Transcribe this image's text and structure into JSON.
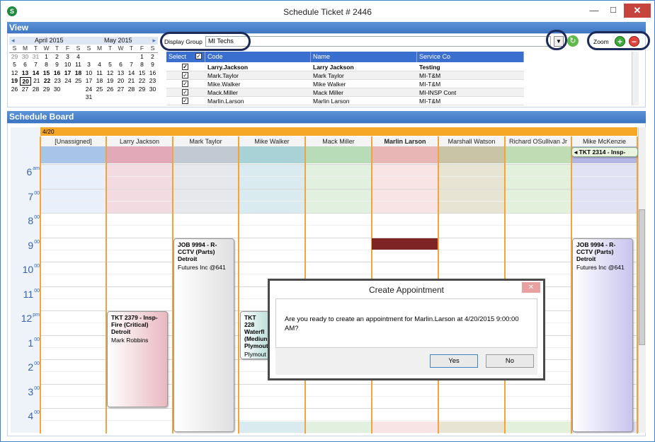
{
  "window": {
    "title": "Schedule Ticket # 2446",
    "app_icon": "S",
    "min": "—",
    "max": "☐",
    "close": "✕"
  },
  "view": {
    "header": "View",
    "calendars": [
      {
        "month": "April 2015",
        "dow": [
          "S",
          "M",
          "T",
          "W",
          "T",
          "F",
          "S"
        ],
        "weeks": [
          [
            "29",
            "30",
            "31",
            "1",
            "2",
            "3",
            "4"
          ],
          [
            "5",
            "6",
            "7",
            "8",
            "9",
            "10",
            "11"
          ],
          [
            "12",
            "13",
            "14",
            "15",
            "16",
            "17",
            "18"
          ],
          [
            "19",
            "20",
            "21",
            "22",
            "23",
            "24",
            "25"
          ],
          [
            "26",
            "27",
            "28",
            "29",
            "30",
            "",
            ""
          ]
        ]
      },
      {
        "month": "May 2015",
        "dow": [
          "S",
          "M",
          "T",
          "W",
          "T",
          "F",
          "S"
        ],
        "weeks": [
          [
            "",
            "",
            "",
            "",
            "",
            "1",
            "2"
          ],
          [
            "3",
            "4",
            "5",
            "6",
            "7",
            "8",
            "9"
          ],
          [
            "10",
            "11",
            "12",
            "13",
            "14",
            "15",
            "16"
          ],
          [
            "17",
            "18",
            "19",
            "20",
            "21",
            "22",
            "23"
          ],
          [
            "24",
            "25",
            "26",
            "27",
            "28",
            "29",
            "30"
          ],
          [
            "31",
            "",
            "",
            "",
            "",
            "",
            ""
          ]
        ]
      }
    ],
    "display_group_label": "Display Group",
    "display_group_value": "MI Techs",
    "zoom_label": "Zoom",
    "grid": {
      "headers": [
        "Select",
        "Code",
        "Name",
        "Service Co"
      ],
      "rows": [
        {
          "code": "Larry.Jackson",
          "name": "Larry Jackson",
          "service": "Testing"
        },
        {
          "code": "Mark.Taylor",
          "name": "Mark Taylor",
          "service": "MI-T&M"
        },
        {
          "code": "Mike.Walker",
          "name": "Mike Walker",
          "service": "MI-T&M"
        },
        {
          "code": "Mack.Miller",
          "name": "Mack Miller",
          "service": "MI-INSP Cont"
        },
        {
          "code": "Marlin.Larson",
          "name": "Marlin Larson",
          "service": "MI-T&M"
        }
      ]
    }
  },
  "board": {
    "header": "Schedule Board",
    "date": "4/20",
    "columns": [
      "[Unassigned]",
      "Larry Jackson",
      "Mark Taylor",
      "Mike Walker",
      "Mack Miller",
      "Marlin Larson",
      "Marshall Watson",
      "Richard OSullivan Jr",
      "Mike McKenzie"
    ],
    "overflow_ticket": "TKT 2314 - Insp-",
    "hours": [
      {
        "h": "6",
        "s": "am"
      },
      {
        "h": "7",
        "s": "00"
      },
      {
        "h": "8",
        "s": "00"
      },
      {
        "h": "9",
        "s": "00"
      },
      {
        "h": "10",
        "s": "00"
      },
      {
        "h": "11",
        "s": "00"
      },
      {
        "h": "12",
        "s": "pm"
      },
      {
        "h": "1",
        "s": "00"
      },
      {
        "h": "2",
        "s": "00"
      },
      {
        "h": "3",
        "s": "00"
      },
      {
        "h": "4",
        "s": "00"
      }
    ],
    "appointments": {
      "a1": {
        "title": "JOB 9994 - R-CCTV (Parts) Detroit",
        "company": "Futures  Inc @641"
      },
      "a2": {
        "title": "TKT 2379 - Insp-Fire (Critical) Detroit",
        "company": "Mark Robbins"
      },
      "a3": {
        "title": "TKT 228 Waterfl (Mediun Plymout",
        "company": "Plymout"
      },
      "a4": {
        "title": "JOB 9994 - R-CCTV (Parts) Detroit",
        "company": "Futures  Inc @641"
      }
    }
  },
  "dialog": {
    "title": "Create Appointment",
    "message": "Are you ready to create an appointment for Marlin.Larson at 4/20/2015 9:00:00 AM?",
    "yes": "Yes",
    "no": "No",
    "close": "✕"
  },
  "colors": {
    "accent": "#3b74c2",
    "date_bar": "#f6a726",
    "blocked": "#7e2424"
  }
}
